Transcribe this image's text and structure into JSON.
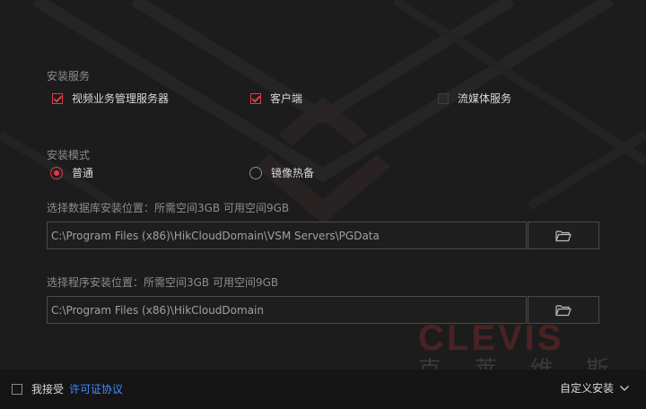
{
  "install_services": {
    "label": "安装服务",
    "options": [
      {
        "label": "视频业务管理服务器",
        "checked": true,
        "enabled": true
      },
      {
        "label": "客户端",
        "checked": true,
        "enabled": true
      },
      {
        "label": "流媒体服务",
        "checked": false,
        "enabled": false
      }
    ]
  },
  "install_mode": {
    "label": "安装模式",
    "options": [
      {
        "label": "普通",
        "selected": true
      },
      {
        "label": "镜像热备",
        "selected": false
      }
    ]
  },
  "db_location": {
    "label": "选择数据库安装位置：所需空间3GB 可用空间9GB",
    "path": "C:\\Program Files (x86)\\HikCloudDomain\\VSM Servers\\PGData",
    "browse_icon": "folder-open-icon"
  },
  "program_location": {
    "label": "选择程序安装位置：所需空间3GB 可用空间9GB",
    "path": "C:\\Program Files (x86)\\HikCloudDomain",
    "browse_icon": "folder-open-icon"
  },
  "footer": {
    "accept_label": "我接受",
    "license_link": "许可证协议",
    "accepted": false,
    "custom_install_label": "自定义安装"
  },
  "watermark": {
    "brand": "CLEVIS",
    "chinese": "克 莱 维 斯"
  },
  "colors": {
    "accent": "#e33a45",
    "link": "#3e8dff",
    "background": "#1c1c1d"
  }
}
